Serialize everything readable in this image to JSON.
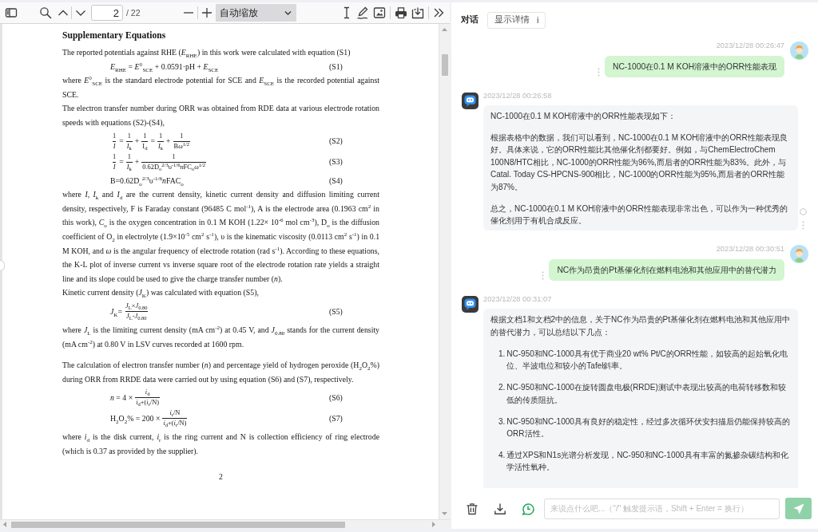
{
  "pdf_toolbar": {
    "page_number": "2",
    "page_count": "/ 22",
    "zoom_level": "自动缩放"
  },
  "pdf_page": {
    "heading": "Supplementary Equations",
    "sections": [
      {
        "blocks": [
          {
            "kind": "paragraph",
            "text": "The reported potentials against RHE (*E*$_{RHE}$) in this work were calculated with equation (S1)"
          },
          {
            "kind": "equation",
            "tag": "(S1)",
            "parts": [
              {
                "kind": "text",
                "text": "*E*$_{RHE}$ = *E*°$_{SCE}$ + 0.0591·pH + *E*$_{SCE}$"
              }
            ]
          },
          {
            "kind": "paragraph",
            "text": "where *E*°$_{SCE}$ is the standard electrode potential for SCE and *E*$_{SCE}$ is the recorded potential against SCE."
          },
          {
            "kind": "paragraph",
            "text": "The electron transfer number during ORR was obtained from RDE data at various electrode rotation speeds with equations (S2)-(S4),"
          },
          {
            "kind": "equation",
            "tag": "(S2)",
            "parts": [
              {
                "kind": "frac",
                "numerator": "1",
                "denominator": "*I*"
              },
              {
                "kind": "text",
                "text": "="
              },
              {
                "kind": "frac",
                "numerator": "1",
                "denominator": "*I*$_{k}$"
              },
              {
                "kind": "text",
                "text": "+"
              },
              {
                "kind": "frac",
                "numerator": "1",
                "denominator": "I$_{d}$"
              },
              {
                "kind": "text",
                "text": "="
              },
              {
                "kind": "frac",
                "numerator": "1",
                "denominator": "*I*$_{k}$"
              },
              {
                "kind": "text",
                "text": "+"
              },
              {
                "kind": "frac",
                "numerator": "1",
                "denominator": "Bω$^{1/2}$"
              }
            ]
          },
          {
            "kind": "equation",
            "tag": "(S3)",
            "parts": [
              {
                "kind": "frac",
                "numerator": "1",
                "denominator": "*I*"
              },
              {
                "kind": "text",
                "text": "="
              },
              {
                "kind": "frac",
                "numerator": "1",
                "denominator": "*I*$_{k}$"
              },
              {
                "kind": "text",
                "text": "+"
              },
              {
                "kind": "frac",
                "numerator": "1",
                "denominator": [
                  "0.62D$_{o}$$^{2/3}$υ$^{-1/6}$",
                  "*n*",
                  "FC$_{o}$ω$^{1/2}$"
                ]
              }
            ]
          },
          {
            "kind": "equation",
            "tag": "(S4)",
            "parts": [
              {
                "kind": "text",
                "text": [
                  "B=0.62D$_{o}$$^{2/3}$υ$^{-1/6}$",
                  "*n*",
                  "FAC$_{o}$"
                ]
              }
            ]
          },
          {
            "kind": "paragraph",
            "text": "where *I*, *I*$_{k}$ and *I*$_{d}$ are the current density, kinetic current density and diffusion limiting current density, respectively, F is Faraday constant (96485 C mol$^{-1}$), A is the electrode area (0.1963 cm$^{2}$ in this work), *C*$_{o}$ is the oxygen concentration in 0.1 M KOH (1.22× 10$^{-6}$ mol cm$^{-3}$), D$_{o}$ is the diffusion coefficient of O$_{2}$ in electrolyte (1.9×10$^{-5}$ cm$^{2}$ s$^{-1}$), υ is the kinematic viscosity (0.0113 cm$^{2}$ s$^{-1}$) in 0.1 M KOH, and *ω* is the angular frequency of electrode rotation (rad s$^{-1}$). According to these equations, the K-L plot of inverse current vs inverse square root of the electrode rotation rate yields a straight line and its slope could be used to give the charge transfer number (*n*)."
          },
          {
            "kind": "paragraph",
            "text": "Kinetic current density (*J*$_{K}$) was calculated with equation (S5),"
          },
          {
            "kind": "equation",
            "tag": "(S5)",
            "parts": [
              {
                "kind": "text",
                "text": "*J*$_{K}$="
              },
              {
                "kind": "frac",
                "numerator": "*J*$_{L}$×*J*$_{0.80}$",
                "denominator": "*J*$_{L}$-*J*$_{0.80}$"
              }
            ]
          },
          {
            "kind": "paragraph",
            "text": "where *J*$_{L}$ is the limiting current density (mA cm$^{-2}$) at 0.45 V, and *J*$_{0.80}$ stands for the current density (mA cm$^{-2}$) at 0.80 V in LSV curves recorded at 1600 rpm."
          }
        ]
      },
      {
        "blocks": [
          {
            "kind": "paragraph",
            "text": "The calculation of electron transfer number (*n*) and percentage yield of hydrogen peroxide (H$_{2}$O$_{2}$%) during ORR from RRDE data were carried out by using equation (S6) and (S7), respectively."
          },
          {
            "kind": "equation",
            "tag": "(S6)",
            "parts": [
              {
                "kind": "text",
                "text": "*n* = 4 ×"
              },
              {
                "kind": "frac",
                "numerator": "*i*$_{d}$",
                "denominator": "*i*$_{d}$+(*i*$_{r}$/N)"
              }
            ]
          },
          {
            "kind": "equation",
            "tag": "(S7)",
            "parts": [
              {
                "kind": "text",
                "text": "H$_{2}$O$_{2}$% =  200 ×"
              },
              {
                "kind": "frac",
                "numerator": "*i*$_{r}$/N",
                "denominator": "*i*$_{d}$+(*i*$_{r}$/N)"
              }
            ]
          },
          {
            "kind": "paragraph",
            "text": "where *i*$_{d}$ is the disk current, *i*$_{r}$ is the ring current and N is collection efficiency of ring electrode (which is 0.37 as provided by the supplier)."
          }
        ]
      }
    ],
    "page_number": "2"
  },
  "chat": {
    "title": "对话",
    "details_button": {
      "label": "显示详情",
      "icon": "i"
    },
    "messages": [
      {
        "kind": "user",
        "time": "2023/12/28 00:26:47",
        "blocks": [
          {
            "kind": "paragraph",
            "text": "NC-1000在0.1 M KOH溶液中的ORR性能表现"
          }
        ]
      },
      {
        "kind": "assistant",
        "time": "2023/12/28 00:26:58",
        "blocks": [
          {
            "kind": "paragraph",
            "text": "NC-1000在0.1 M KOH溶液中的ORR性能表现如下："
          },
          {
            "kind": "paragraph",
            "text": "根据表格中的数据，我们可以看到，NC-1000在0.1 M KOH溶液中的ORR性能表现良好。具体来说，它的ORR性能比其他催化剂都要好。例如，与ChemElectroChem 100N8/HTC相比，NC-1000的ORR性能为96%,而后者的ORR性能为83%。此外，与Catal. Today CS-HPCNS-900相比，NC-1000的ORR性能为95%,而后者的ORR性能为87%。"
          },
          {
            "kind": "paragraph",
            "text": "总之，NC-1000在0.1 M KOH溶液中的ORR性能表现非常出色，可以作为一种优秀的催化剂用于有机合成反应。"
          }
        ]
      },
      {
        "kind": "user",
        "time": "2023/12/28 00:30:51",
        "blocks": [
          {
            "kind": "paragraph",
            "text": "NC作为昂贵的Pt基催化剂在燃料电池和其他应用中的替代潜力"
          }
        ]
      },
      {
        "kind": "assistant",
        "time": "2023/12/28 00:31:07",
        "blocks": [
          {
            "kind": "paragraph",
            "text": "根据文档1和文档2中的信息，关于NC作为昂贵的Pt基催化剂在燃料电池和其他应用中的替代潜力，可以总结以下几点："
          },
          {
            "kind": "list",
            "items": [
              {
                "number": "1.",
                "text": "NC-950和NC-1000具有优于商业20 wt% Pt/C的ORR性能，如较高的起始氧化电位、半波电位和较小的Tafel斜率。"
              },
              {
                "number": "2.",
                "text": "NC-950和NC-1000在旋转圆盘电极(RRDE)测试中表现出较高的电荷转移数和较低的传质阻抗。"
              },
              {
                "number": "3.",
                "text": "NC-950和NC-1000具有良好的稳定性，经过多次循环伏安扫描后仍能保持较高的ORR活性。"
              },
              {
                "number": "4.",
                "text": "通过XPS和N1s光谱分析发现，NC-950和NC-1000具有丰富的氮掺杂碳结构和化学活性氧种。"
              }
            ]
          }
        ]
      }
    ],
    "composer": {
      "placeholder": "来说点什么吧...（\"/\" 触发提示语，Shift + Enter = 换行）"
    }
  }
}
